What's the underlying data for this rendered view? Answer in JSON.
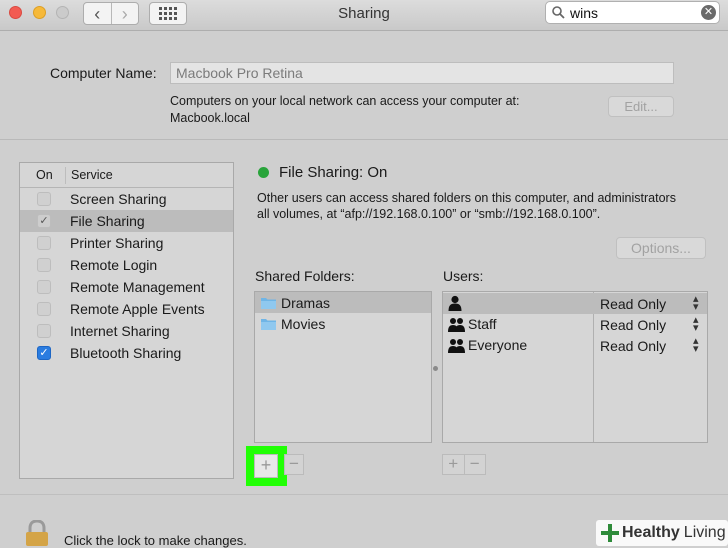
{
  "window": {
    "title": "Sharing",
    "search_value": "wins"
  },
  "computer_name": {
    "label": "Computer Name:",
    "value": "Macbook Pro Retina",
    "info_line1": "Computers on your local network can access your computer at:",
    "info_line2": "Macbook.local",
    "edit_label": "Edit..."
  },
  "services": {
    "header_on": "On",
    "header_service": "Service",
    "items": [
      {
        "label": "Screen Sharing",
        "checked": false
      },
      {
        "label": "File Sharing",
        "checked": true,
        "selected": true
      },
      {
        "label": "Printer Sharing",
        "checked": false
      },
      {
        "label": "Remote Login",
        "checked": false
      },
      {
        "label": "Remote Management",
        "checked": false
      },
      {
        "label": "Remote Apple Events",
        "checked": false
      },
      {
        "label": "Internet Sharing",
        "checked": false
      },
      {
        "label": "Bluetooth Sharing",
        "checked": true
      }
    ]
  },
  "file_sharing": {
    "status": "File Sharing: On",
    "status_color": "#29a43b",
    "desc_line1": "Other users can access shared folders on this computer, and administrators",
    "desc_line2": "all volumes, at “afp://192.168.0.100” or “smb://192.168.0.100”.",
    "options_label": "Options...",
    "shared_folders_label": "Shared Folders:",
    "users_label": "Users:",
    "folders": [
      "Dramas",
      "Movies"
    ],
    "users": [
      {
        "name": "",
        "permission": "Read Only",
        "icon": "single-user-icon"
      },
      {
        "name": "Staff",
        "permission": "Read Only",
        "icon": "group-icon"
      },
      {
        "name": "Everyone",
        "permission": "Read Only",
        "icon": "group-icon"
      }
    ],
    "add_symbol": "+",
    "remove_symbol": "−"
  },
  "footer": {
    "lock_text": "Click the lock to make changes."
  },
  "watermark": {
    "bold": "Healthy",
    "regular": "Living"
  },
  "colors": {
    "highlight": "#21ff05",
    "checkbox_blue": "#2a7ce0"
  }
}
